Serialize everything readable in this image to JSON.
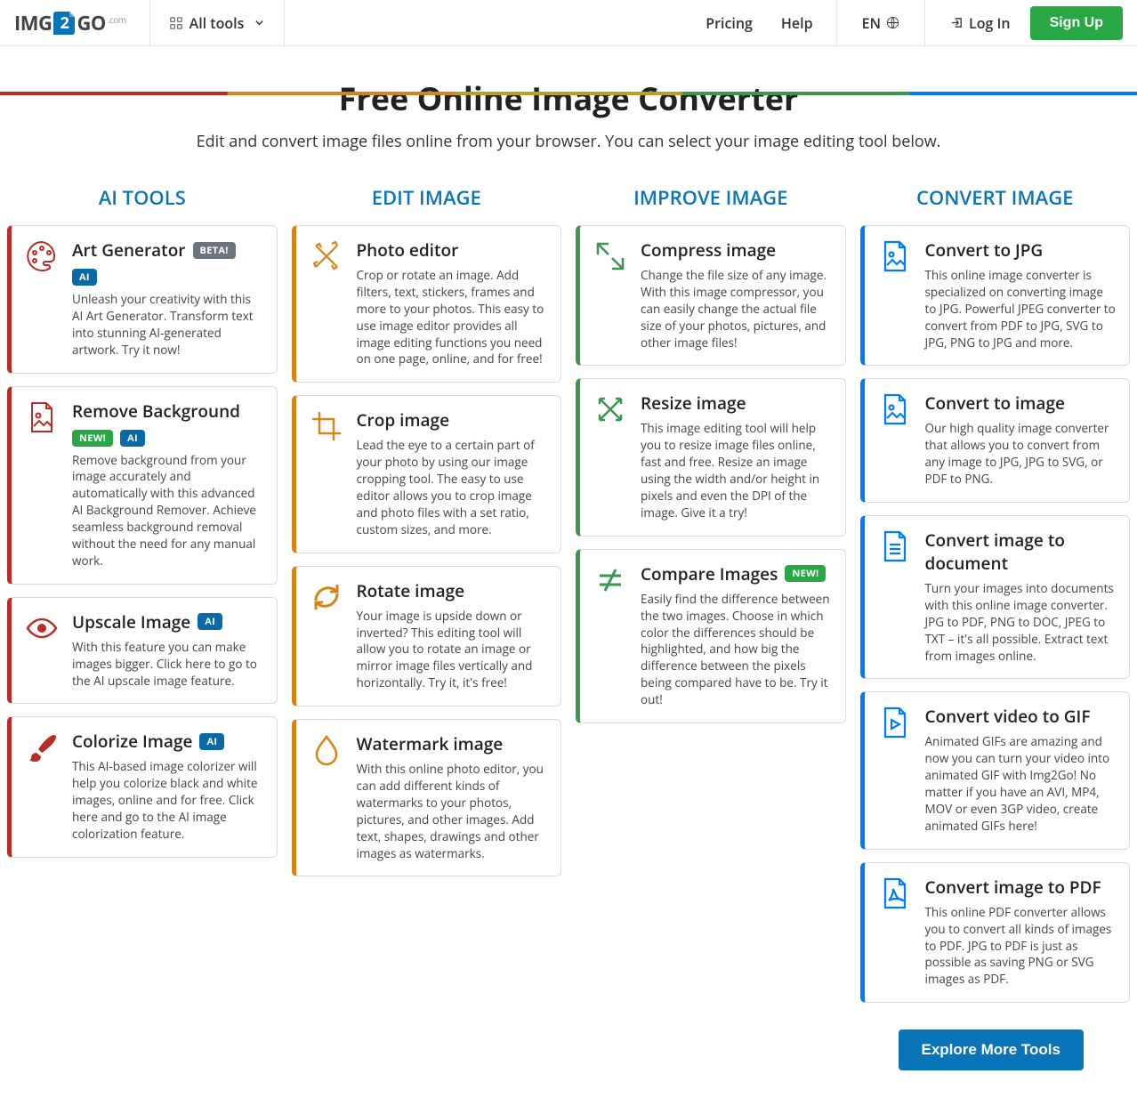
{
  "header": {
    "logo": {
      "img": "IMG",
      "two": "2",
      "go": "GO",
      "com": ".com"
    },
    "all_tools": "All tools",
    "pricing": "Pricing",
    "help": "Help",
    "lang": "EN",
    "login": "Log In",
    "signup": "Sign Up"
  },
  "hero": {
    "title": "Free Online Image Converter",
    "subtitle": "Edit and convert image files online from your browser. You can select your image editing tool below."
  },
  "badges": {
    "beta": "BETA!",
    "new": "NEW!",
    "ai": "AI"
  },
  "sections": {
    "ai": {
      "title": "AI TOOLS"
    },
    "edit": {
      "title": "EDIT IMAGE"
    },
    "improve": {
      "title": "IMPROVE IMAGE"
    },
    "convert": {
      "title": "CONVERT IMAGE"
    }
  },
  "cards": {
    "ai": [
      {
        "title": "Art Generator",
        "badges": [
          "beta",
          "ai"
        ],
        "desc": "Unleash your creativity with this AI Art Generator. Transform text into stunning AI-generated artwork. Try it now!"
      },
      {
        "title": "Remove Background",
        "badges": [
          "new",
          "ai"
        ],
        "desc": "Remove background from your image accurately and automatically with this advanced AI Background Remover. Achieve seamless background removal without the need for any manual work."
      },
      {
        "title": "Upscale Image",
        "badges": [
          "ai"
        ],
        "desc": "With this feature you can make images bigger. Click here to go to the AI upscale image feature."
      },
      {
        "title": "Colorize Image",
        "badges": [
          "ai"
        ],
        "desc": "This AI-based image colorizer will help you colorize black and white images, online and for free. Click here and go to the AI image colorization feature."
      }
    ],
    "edit": [
      {
        "title": "Photo editor",
        "badges": [],
        "desc": "Crop or rotate an image. Add filters, text, stickers, frames and more to your photos. This easy to use image editor provides all image editing functions you need on one page, online, and for free!"
      },
      {
        "title": "Crop image",
        "badges": [],
        "desc": "Lead the eye to a certain part of your photo by using our image cropping tool. The easy to use editor allows you to crop image and photo files with a set ratio, custom sizes, and more."
      },
      {
        "title": "Rotate image",
        "badges": [],
        "desc": "Your image is upside down or inverted? This editing tool will allow you to rotate an image or mirror image files vertically and horizontally. Try it, it's free!"
      },
      {
        "title": "Watermark image",
        "badges": [],
        "desc": "With this online photo editor, you can add different kinds of watermarks to your photos, pictures, and other images. Add text, shapes, drawings and other images as watermarks."
      }
    ],
    "improve": [
      {
        "title": "Compress image",
        "badges": [],
        "desc": "Change the file size of any image. With this image compressor, you can easily change the actual file size of your photos, pictures, and other image files!"
      },
      {
        "title": "Resize image",
        "badges": [],
        "desc": "This image editing tool will help you to resize image files online, fast and free. Resize an image using the width and/or height in pixels and even the DPI of the image. Give it a try!"
      },
      {
        "title": "Compare Images",
        "badges": [
          "new"
        ],
        "desc": "Easily find the difference between the two images. Choose in which color the differences should be highlighted, and how big the difference between the pixels being compared have to be. Try it out!"
      }
    ],
    "convert": [
      {
        "title": "Convert to JPG",
        "badges": [],
        "desc": "This online image converter is specialized on converting image to JPG. Powerful JPEG converter to convert from PDF to JPG, SVG to JPG, PNG to JPG and more."
      },
      {
        "title": "Convert to image",
        "badges": [],
        "desc": "Our high quality image converter that allows you to convert from any image to JPG, JPG to SVG, or PDF to PNG."
      },
      {
        "title": "Convert image to document",
        "badges": [],
        "desc": "Turn your images into documents with this online image converter. JPG to PDF, PNG to DOC, JPEG to TXT – it's all possible. Extract text from images online."
      },
      {
        "title": "Convert video to GIF",
        "badges": [],
        "desc": "Animated GIFs are amazing and now you can turn your video into animated GIF with Img2Go! No matter if you have an AVI, MP4, MOV or even 3GP video, create animated GIFs here!"
      },
      {
        "title": "Convert image to PDF",
        "badges": [],
        "desc": "This online PDF converter allows you to convert all kinds of images to PDF. JPG to PDF is just as possible as saving PNG or SVG images as PDF."
      }
    ]
  },
  "more_button": "Explore More Tools"
}
